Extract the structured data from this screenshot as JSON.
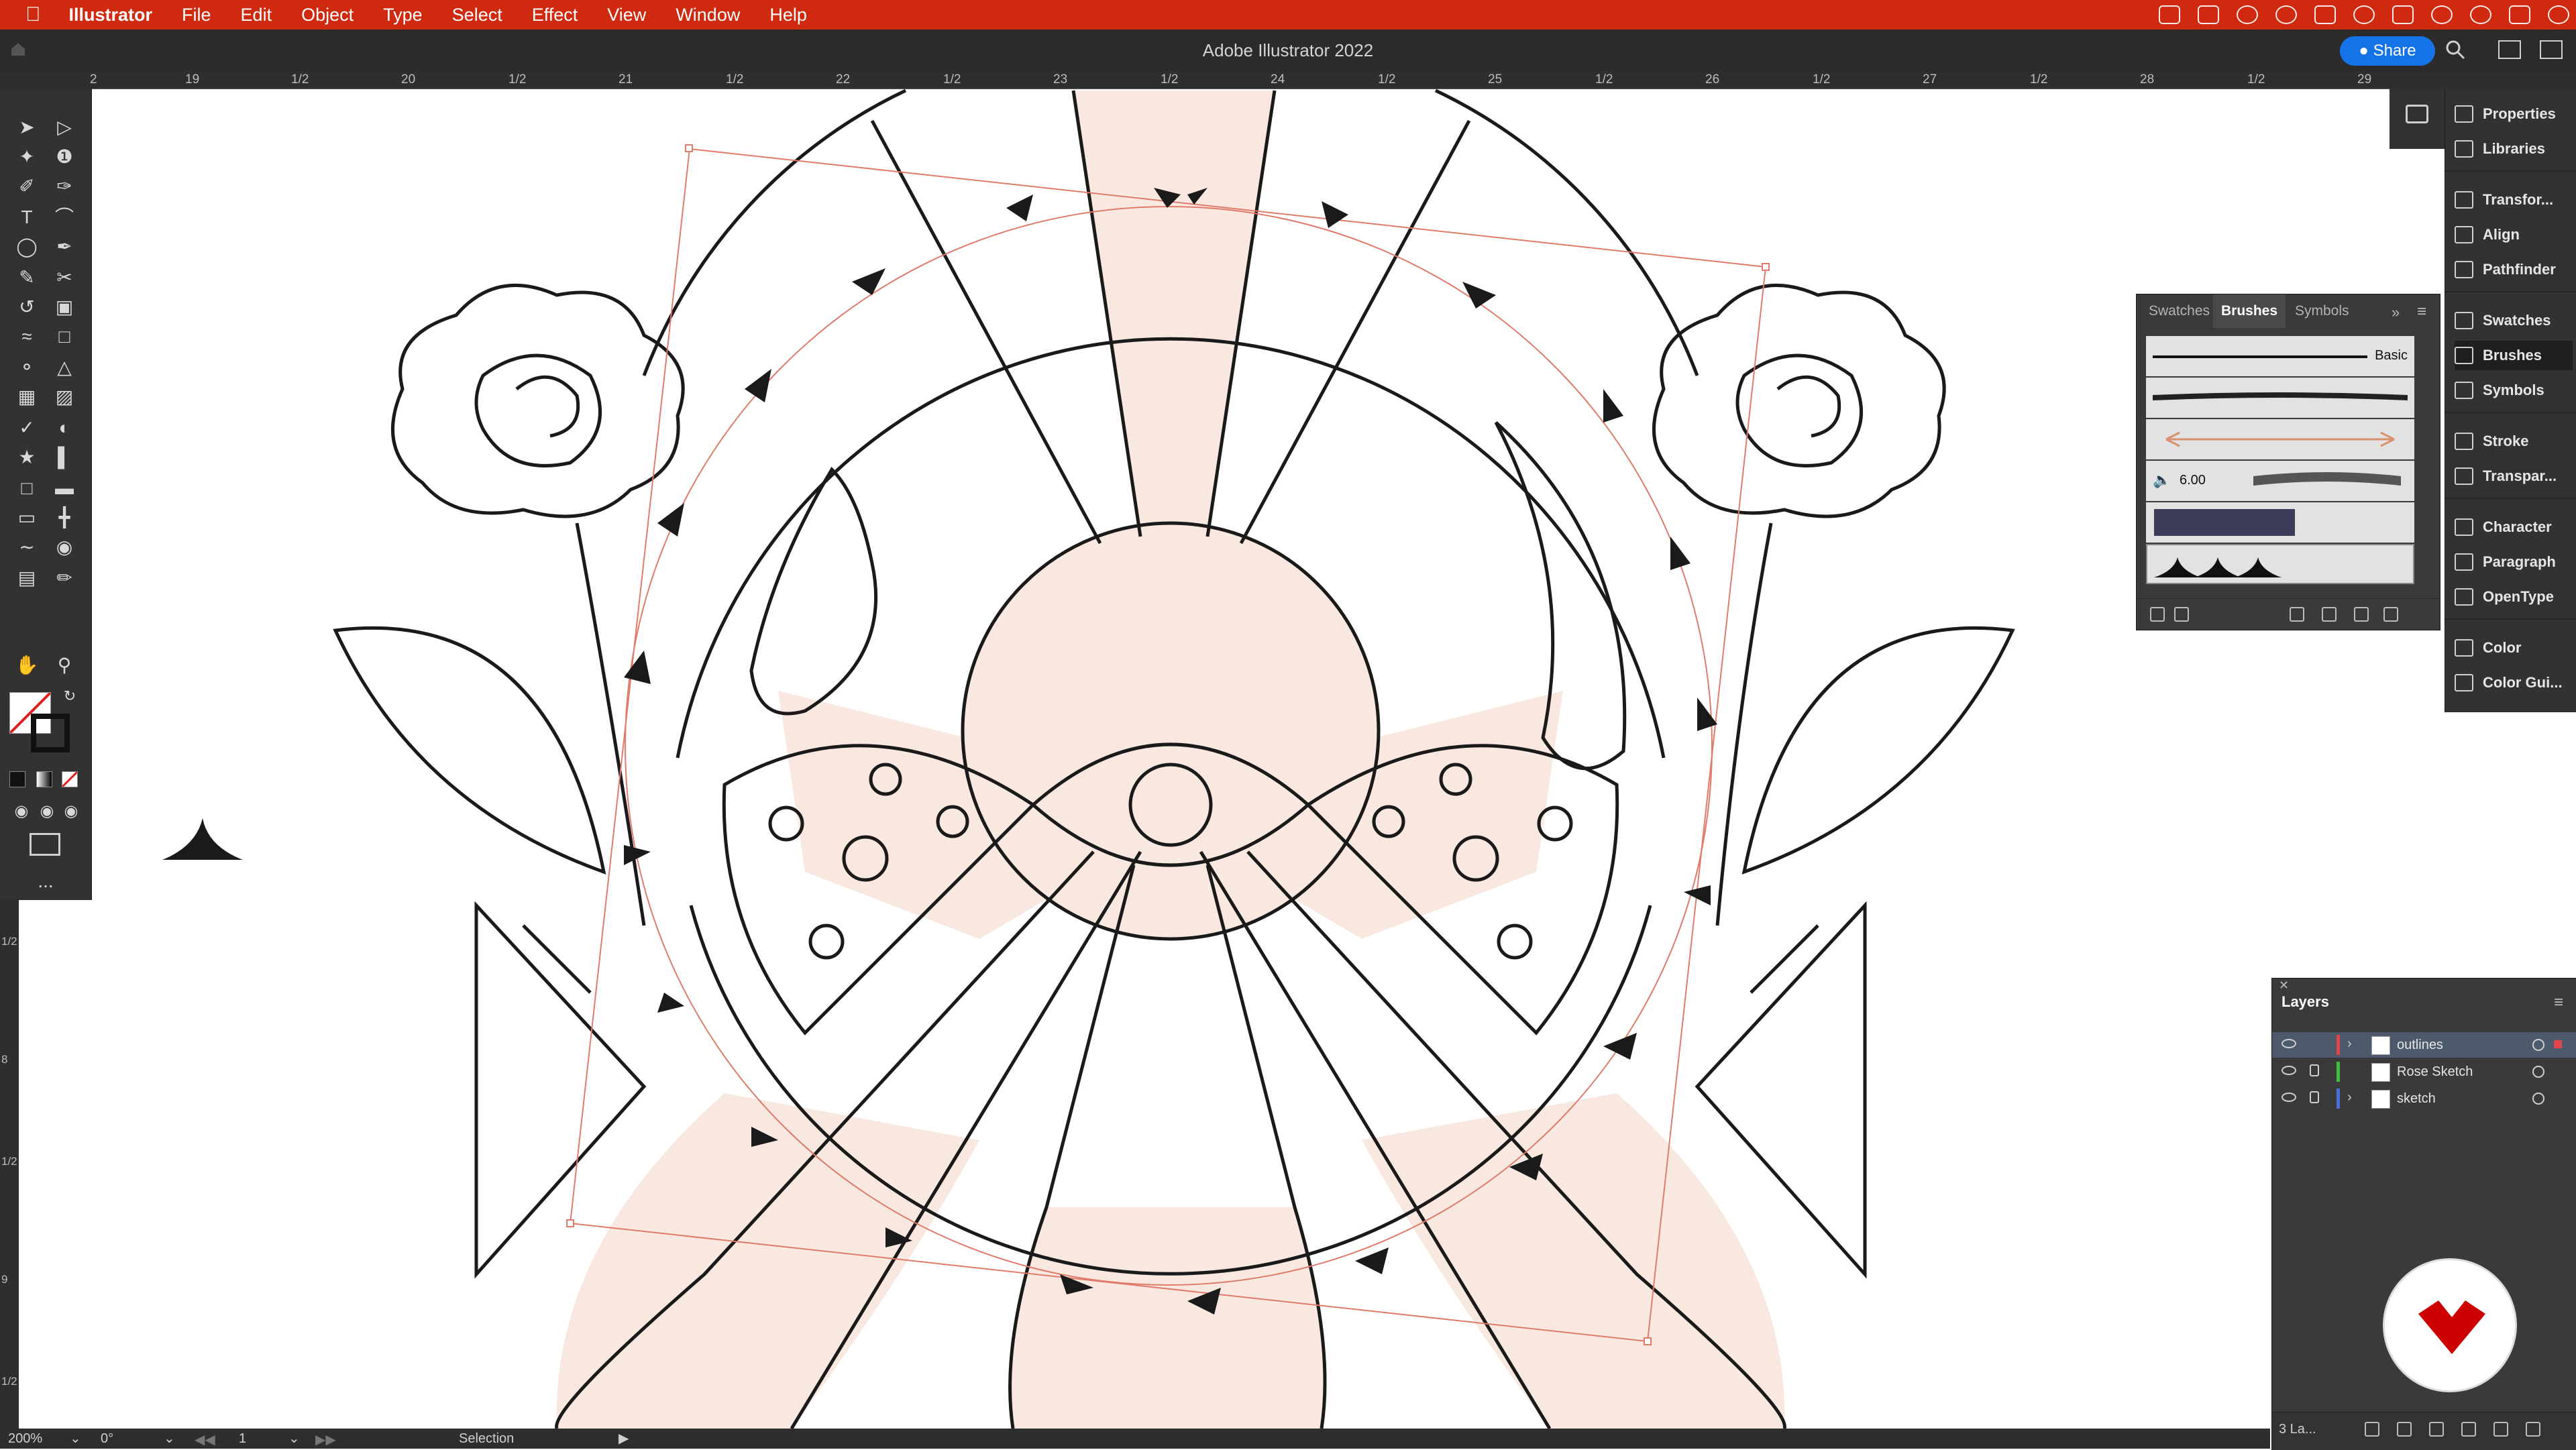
{
  "menubar": {
    "apple": "",
    "app_name": "Illustrator",
    "items": [
      "File",
      "Edit",
      "Object",
      "Type",
      "Select",
      "Effect",
      "View",
      "Window",
      "Help"
    ],
    "color": "#cf2a0f"
  },
  "appbar": {
    "title": "Adobe Illustrator 2022",
    "share_label": "Share"
  },
  "ruler": {
    "labels": [
      "2",
      "19",
      "1/2",
      "20",
      "1/2",
      "21",
      "1/2",
      "22",
      "1/2",
      "23",
      "1/2",
      "24",
      "1/2",
      "25",
      "1/2",
      "26",
      "1/2",
      "27",
      "1/2",
      "28",
      "1/2",
      "29"
    ],
    "vertical_labels": [
      "1/2",
      "8",
      "1/2",
      "9",
      "1/2"
    ]
  },
  "toolbar": {
    "tools": [
      "selection-tool",
      "direct-selection-tool",
      "magic-wand-tool",
      "lasso-tool",
      "pen-tool",
      "curvature-tool",
      "type-tool",
      "arc-tool",
      "ellipse-tool",
      "paintbrush-tool",
      "shaper-tool",
      "scissors-tool",
      "rotate-tool",
      "scale-tool",
      "warp-tool",
      "free-transform-tool",
      "shape-builder-tool",
      "perspective-tool",
      "mesh-tool",
      "gradient-tool",
      "eyedropper-tool",
      "blend-tool",
      "symbol-sprayer-tool",
      "graph-tool",
      "artboard-tool",
      "slice-tool",
      "eraser-tool",
      "knife-tool",
      "hand-tool",
      "zoom-tool"
    ],
    "more_label": "..."
  },
  "dock": {
    "items": [
      {
        "label": "Properties",
        "icon": "properties-icon"
      },
      {
        "label": "Libraries",
        "icon": "libraries-icon"
      },
      {
        "label": "Transfor...",
        "icon": "transform-icon"
      },
      {
        "label": "Align",
        "icon": "align-icon"
      },
      {
        "label": "Pathfinder",
        "icon": "pathfinder-icon"
      },
      {
        "label": "Swatches",
        "icon": "swatches-icon"
      },
      {
        "label": "Brushes",
        "icon": "brushes-icon"
      },
      {
        "label": "Symbols",
        "icon": "symbols-icon"
      },
      {
        "label": "Stroke",
        "icon": "stroke-icon"
      },
      {
        "label": "Transpar...",
        "icon": "transparency-icon"
      },
      {
        "label": "Character",
        "icon": "character-icon"
      },
      {
        "label": "Paragraph",
        "icon": "paragraph-icon"
      },
      {
        "label": "OpenType",
        "icon": "opentype-icon"
      },
      {
        "label": "Color",
        "icon": "color-icon"
      },
      {
        "label": "Color Gui...",
        "icon": "color-guide-icon"
      }
    ]
  },
  "brushes_panel": {
    "tabs": [
      "Swatches",
      "Brushes",
      "Symbols"
    ],
    "active_tab": "Brushes",
    "basic_label": "Basic",
    "size_value": "6.00"
  },
  "layers_panel": {
    "title": "Layers",
    "layers": [
      {
        "name": "outlines",
        "color": "#e0464b",
        "selected": true,
        "locked": false,
        "expandable": true
      },
      {
        "name": "Rose Sketch",
        "color": "#3fbf3f",
        "selected": false,
        "locked": true,
        "expandable": false
      },
      {
        "name": "sketch",
        "color": "#4b6ee0",
        "selected": false,
        "locked": true,
        "expandable": true
      }
    ],
    "footer_count": "3 La..."
  },
  "statusbar": {
    "zoom": "200%",
    "rotation": "0°",
    "artboard": "1",
    "tool": "Selection"
  }
}
